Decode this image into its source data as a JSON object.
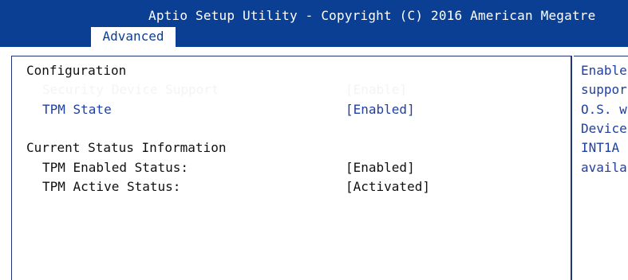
{
  "header": {
    "title": "Aptio Setup Utility - Copyright (C) 2016 American Megatre",
    "tabs": [
      {
        "label": "Advanced",
        "active": true
      }
    ]
  },
  "main": {
    "sections": [
      {
        "heading": "Configuration",
        "items": [
          {
            "label": "Security Device Support",
            "value": "[Enable]",
            "selected": true
          },
          {
            "label": "TPM State",
            "value": "[Enabled]",
            "selected": false
          }
        ]
      },
      {
        "heading": "Current Status Information",
        "items": [
          {
            "label": "TPM Enabled Status:",
            "value": "[Enabled]"
          },
          {
            "label": "TPM Active Status:",
            "value": "[Activated]"
          }
        ]
      }
    ]
  },
  "help": {
    "lines": [
      "Enable",
      "suppor",
      "O.S. w",
      "Device",
      "INT1A",
      "availa"
    ]
  },
  "colors": {
    "header_bg": "#0a3f93",
    "selected_text": "#f4f4f4",
    "option_text": "#1f3fa3",
    "static_text": "#111111",
    "panel_border": "#22347a"
  }
}
